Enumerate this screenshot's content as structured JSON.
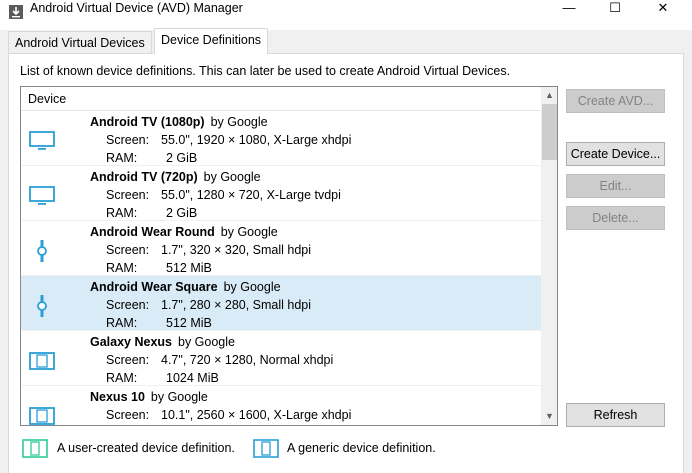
{
  "window": {
    "title": "Android Virtual Device (AVD) Manager",
    "minimize": "—",
    "maximize": "☐",
    "close": "✕"
  },
  "tabs": [
    {
      "label": "Android Virtual Devices",
      "active": false
    },
    {
      "label": "Device Definitions",
      "active": true
    }
  ],
  "description": "List of known device definitions. This can later be used to create Android Virtual Devices.",
  "list": {
    "header": "Device",
    "screen_label": "Screen:",
    "ram_label": "RAM:",
    "rows": [
      {
        "name": "Android TV (1080p)",
        "by": "by Google",
        "screen": "55.0\", 1920 × 1080, X-Large xhdpi",
        "ram": "2 GiB",
        "icon": "tv-icon",
        "selected": false
      },
      {
        "name": "Android TV (720p)",
        "by": "by Google",
        "screen": "55.0\", 1280 × 720, X-Large tvdpi",
        "ram": "2 GiB",
        "icon": "tv-icon",
        "selected": false
      },
      {
        "name": "Android Wear Round",
        "by": "by Google",
        "screen": "1.7\", 320 × 320, Small hdpi",
        "ram": "512 MiB",
        "icon": "watch-icon",
        "selected": false
      },
      {
        "name": "Android Wear Square",
        "by": "by Google",
        "screen": "1.7\", 280 × 280, Small hdpi",
        "ram": "512 MiB",
        "icon": "watch-icon",
        "selected": true
      },
      {
        "name": "Galaxy Nexus",
        "by": "by Google",
        "screen": "4.7\", 720 × 1280, Normal xhdpi",
        "ram": "1024 MiB",
        "icon": "tablet-icon",
        "selected": false
      },
      {
        "name": "Nexus 10",
        "by": "by Google",
        "screen": "10.1\", 2560 × 1600, X-Large xhdpi",
        "ram": "",
        "icon": "tablet-icon",
        "selected": false
      }
    ]
  },
  "buttons": {
    "create_avd": "Create AVD...",
    "create_device": "Create Device...",
    "edit": "Edit...",
    "delete": "Delete...",
    "refresh": "Refresh"
  },
  "legend": {
    "user_created": "A user-created device definition.",
    "generic": "A generic device definition."
  },
  "colors": {
    "selection": "#d9ebf7",
    "user_icon": "#2ecc9a",
    "generic_icon": "#2a9fd6"
  }
}
